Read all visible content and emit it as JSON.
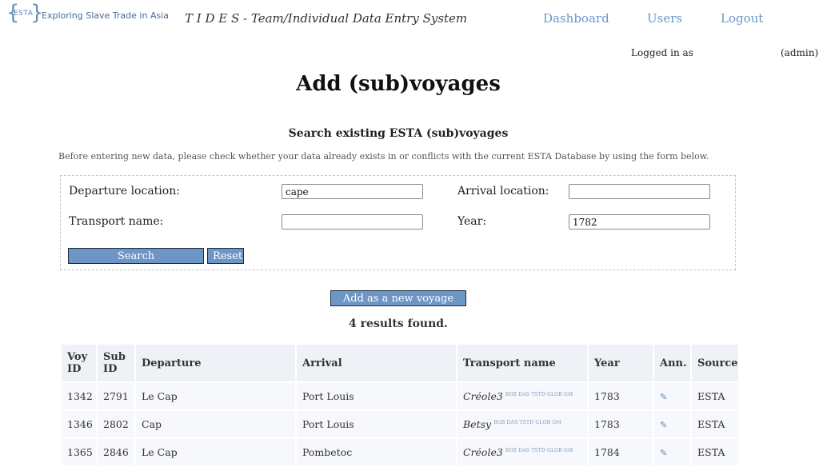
{
  "header": {
    "logo_mark": "ESTA",
    "logo_text": "Exploring Slave Trade in Asia",
    "app_title": "T I D E S - Team/Individual Data Entry System",
    "nav": [
      "Dashboard",
      "Users",
      "Logout"
    ],
    "logged_in_label": "Logged in as",
    "role": "(admin)"
  },
  "page_title": "Add (sub)voyages",
  "search": {
    "section_title": "Search existing ESTA (sub)voyages",
    "intro": "Before entering new data, please check whether your data already exists in or conflicts with the current ESTA Database by using the form below.",
    "departure_label": "Departure location:",
    "departure_value": "cape",
    "arrival_label": "Arrival location:",
    "arrival_value": "",
    "transport_label": "Transport name:",
    "transport_value": "",
    "year_label": "Year:",
    "year_value": "1782",
    "search_button": "Search",
    "reset_button": "Reset"
  },
  "add_new_button": "Add as a new voyage",
  "results_count": "4 results found.",
  "table": {
    "headers": {
      "voy_id_1": "Voy",
      "voy_id_2": "ID",
      "sub_id_1": "Sub",
      "sub_id_2": "ID",
      "departure": "Departure",
      "arrival": "Arrival",
      "transport": "Transport name",
      "year": "Year",
      "ann": "Ann.",
      "source": "Source"
    },
    "rows": [
      {
        "voy_id": "1342",
        "sub_id": "2791",
        "departure": "Le Cap",
        "arrival": "Port Louis",
        "transport": "Créole3",
        "tags": "BGB DAS TSTD GLOB GM",
        "year": "1783",
        "source": "ESTA"
      },
      {
        "voy_id": "1346",
        "sub_id": "2802",
        "departure": "Cap",
        "arrival": "Port Louis",
        "transport": "Betsy",
        "tags": "BGB DAS TSTD GLOB GM",
        "year": "1783",
        "source": "ESTA"
      },
      {
        "voy_id": "1365",
        "sub_id": "2846",
        "departure": "Le Cap",
        "arrival": "Pombetoc",
        "transport": "Créole3",
        "tags": "BGB DAS TSTD GLOB GM",
        "year": "1784",
        "source": "ESTA"
      }
    ]
  },
  "icons": {
    "annotation": "pencil-icon"
  },
  "colors": {
    "accent": "#6d95c6",
    "link": "#5a87b8",
    "header_bg": "#eef2f7"
  }
}
